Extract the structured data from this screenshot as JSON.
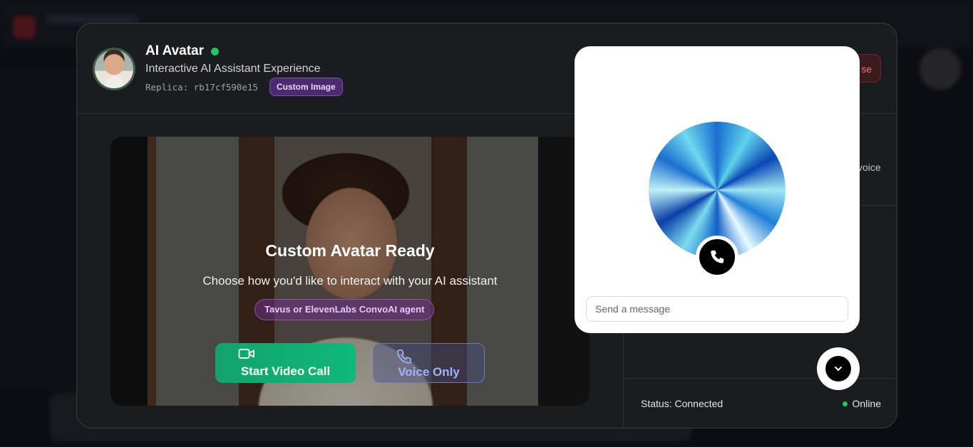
{
  "header": {
    "title": "AI Avatar",
    "subtitle": "Interactive AI Assistant Experience",
    "replica": "Replica: rb17cf590e15",
    "badge": "Custom Image",
    "close_label": "se"
  },
  "side_panel": {
    "voice_text": "voice",
    "status": "Status: Connected",
    "online": "Online"
  },
  "video": {
    "title": "Custom Avatar Ready",
    "subtitle": "Choose how you'd like to interact with your AI assistant",
    "agent_badge": "Tavus or ElevenLabs ConvoAI agent",
    "video_button": "Start Video Call",
    "voice_button": "Voice Only"
  },
  "widget": {
    "message_placeholder": "Send a message"
  },
  "icons": {
    "call": "phone-icon",
    "video": "video-camera-icon",
    "voice": "phone-outline-icon",
    "toggle": "chevron-down-icon"
  },
  "colors": {
    "online": "#22c55e",
    "video_button": "#10b077",
    "badge": "#4c2a6e"
  }
}
